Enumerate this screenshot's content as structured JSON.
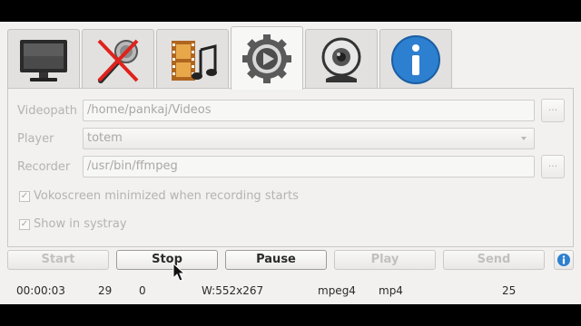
{
  "tabs": [
    {
      "name": "screen",
      "icon": "monitor-icon"
    },
    {
      "name": "audio",
      "icon": "microphone-muted-icon"
    },
    {
      "name": "video",
      "icon": "film-music-icon"
    },
    {
      "name": "settings",
      "icon": "gear-play-icon",
      "active": true
    },
    {
      "name": "webcam",
      "icon": "webcam-icon"
    },
    {
      "name": "info",
      "icon": "info-icon"
    }
  ],
  "settings": {
    "videopath_label": "Videopath",
    "videopath_value": "/home/pankaj/Videos",
    "player_label": "Player",
    "player_value": "totem",
    "recorder_label": "Recorder",
    "recorder_value": "/usr/bin/ffmpeg",
    "browse_label": "...",
    "minimized_label": "Vokoscreen minimized when recording starts",
    "minimized_checked": true,
    "systray_label": "Show in systray",
    "systray_checked": true
  },
  "controls": {
    "start": "Start",
    "stop": "Stop",
    "pause": "Pause",
    "play": "Play",
    "send": "Send"
  },
  "status": {
    "time": "00:00:03",
    "frames": "29",
    "dropped": "0",
    "size": "W:552x267",
    "codec": "mpeg4",
    "format": "mp4",
    "fps": "25"
  },
  "colors": {
    "window_bg": "#f2f1f0",
    "info_blue": "#2d7fd0",
    "disabled_text": "#b4b3b1"
  }
}
